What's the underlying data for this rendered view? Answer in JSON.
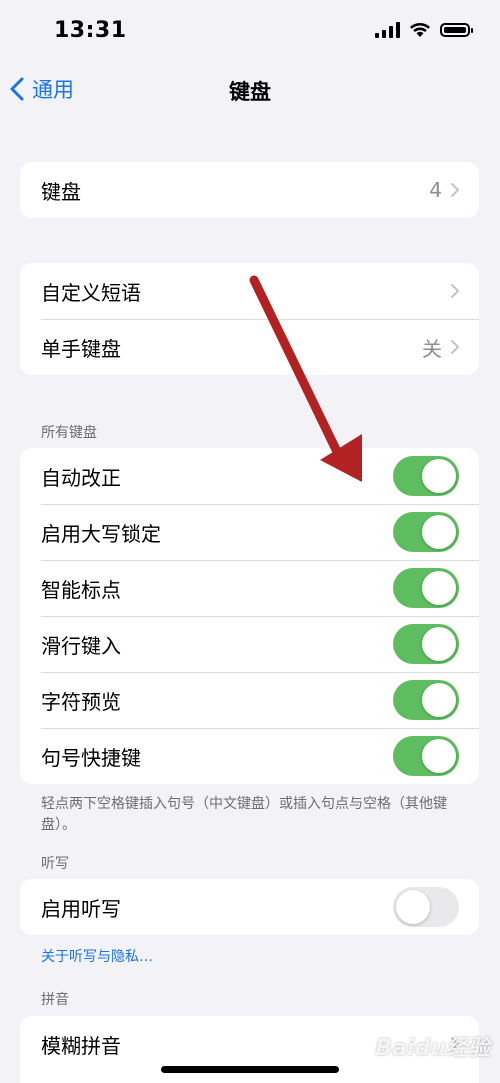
{
  "status_bar": {
    "time": "13:31"
  },
  "nav": {
    "back_label": "通用",
    "title": "键盘"
  },
  "group1": {
    "items": [
      {
        "label": "键盘",
        "value": "4"
      }
    ]
  },
  "group2": {
    "items": [
      {
        "label": "自定义短语",
        "value": ""
      },
      {
        "label": "单手键盘",
        "value": "关"
      }
    ]
  },
  "all_keyboards": {
    "header": "所有键盘",
    "items": [
      {
        "label": "自动改正",
        "enabled": true
      },
      {
        "label": "启用大写锁定",
        "enabled": true
      },
      {
        "label": "智能标点",
        "enabled": true
      },
      {
        "label": "滑行键入",
        "enabled": true
      },
      {
        "label": "字符预览",
        "enabled": true
      },
      {
        "label": "句号快捷键",
        "enabled": true
      }
    ],
    "footer": "轻点两下空格键插入句号（中文键盘）或插入句点与空格（其他键盘）。"
  },
  "dictation": {
    "header": "听写",
    "items": [
      {
        "label": "启用听写",
        "enabled": false
      }
    ],
    "link": "关于听写与隐私…"
  },
  "pinyin": {
    "header": "拼音",
    "items": [
      {
        "label": "模糊拼音"
      }
    ]
  },
  "watermark": "Baidu经验",
  "colors": {
    "accent": "#1a73e8",
    "toggle_on": "#5ebd5e",
    "background": "#f2f2f7",
    "arrow": "#b22222"
  }
}
